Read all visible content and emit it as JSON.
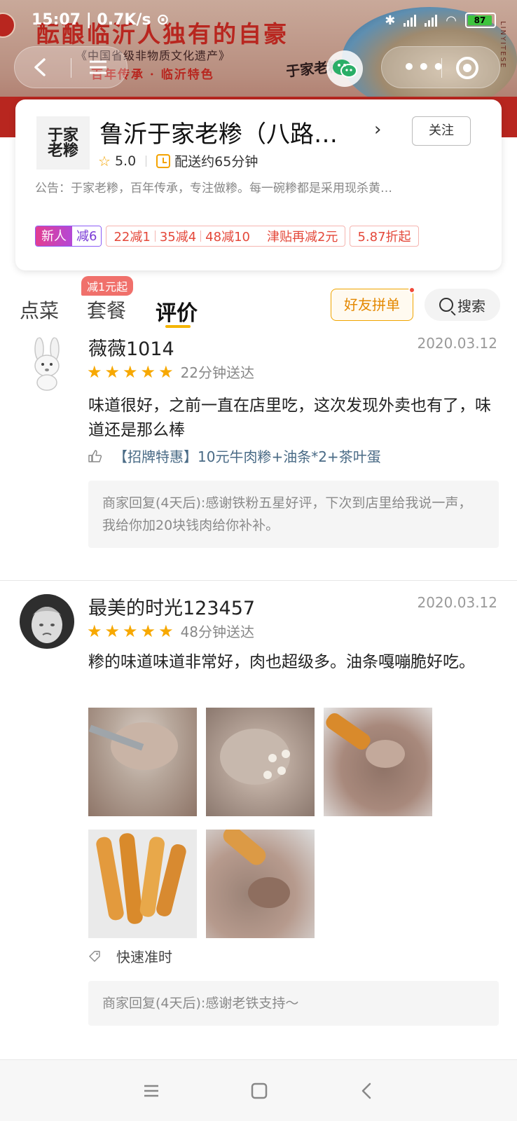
{
  "status_bar": {
    "time": "15:07",
    "speed": "0.7K/s",
    "battery": "87",
    "network": "HD"
  },
  "banner": {
    "slogan": "酝酿临沂人独有的自豪",
    "heritage": "《中国省级非物质文化遗产》",
    "tradition": "百年传承 · 临沂特色",
    "brand_script": "于家老糁",
    "side_text": "LINYITESE"
  },
  "nav": {
    "back_icon": "back-icon",
    "menu_icon": "menu-icon",
    "wechat_icon": "wechat-icon",
    "more_icon": "more-icon",
    "close_icon": "target-icon"
  },
  "store": {
    "logo_text": "于家老糁",
    "name": "鲁沂于家老糁（八路…",
    "follow_label": "关注",
    "rating": "5.0",
    "delivery": "配送约65分钟",
    "notice": "公告：于家老糁，百年传承，专注做糁。每一碗糁都是采用现杀黄…",
    "promos": {
      "new_user_label": "新人",
      "new_user_discount": "减6",
      "tiers": [
        "22减1",
        "35减4",
        "48减10"
      ],
      "subsidy": "津贴再减2元",
      "discount": "5.87折起"
    }
  },
  "tabs": {
    "items": [
      "点菜",
      "套餐",
      "评价"
    ],
    "active_index": 2,
    "combo_badge": "减1元起",
    "friend_order": "好友拼单",
    "search": "搜索"
  },
  "reviews": [
    {
      "user": "薇薇1014",
      "date": "2020.03.12",
      "stars": 5,
      "delivery_time": "22分钟送达",
      "text": "味道很好，之前一直在店里吃，这次发现外卖也有了，味道还是那么棒",
      "liked_item": "【招牌特惠】10元牛肉糁+油条*2+茶叶蛋",
      "reply": "商家回复(4天后):感谢铁粉五星好评，下次到店里给我说一声，我给你加20块钱肉给你补补。"
    },
    {
      "user": "最美的时光123457",
      "date": "2020.03.12",
      "stars": 5,
      "delivery_time": "48分钟送达",
      "text": "糁的味道味道非常好，肉也超级多。油条嘎嘣脆好吃。",
      "tag": "快速准时",
      "reply": "商家回复(4天后):感谢老铁支持～",
      "photo_count": 5
    }
  ],
  "colors": {
    "accent_star": "#f7a800",
    "banner_red": "#b8261f",
    "promo_red": "#e4483a",
    "tab_underline": "#f4b400"
  }
}
